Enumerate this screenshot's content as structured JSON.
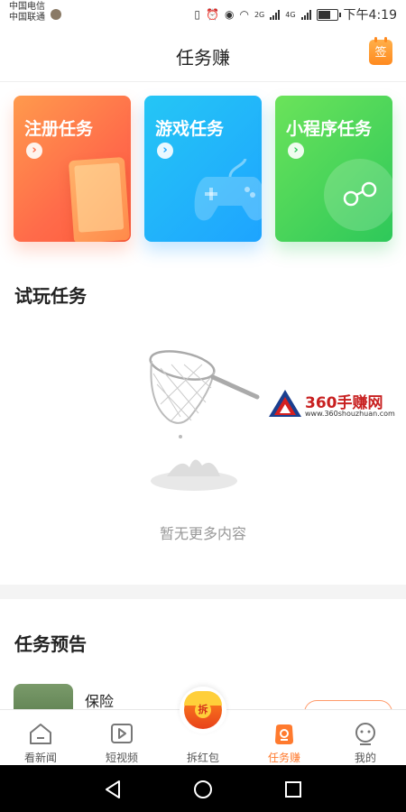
{
  "status_bar": {
    "carrier1": "中国电信",
    "carrier2": "中国联通",
    "net1": "2G",
    "net2": "4G",
    "time": "下午4:19"
  },
  "header": {
    "title": "任务赚",
    "sign_label": "签"
  },
  "task_cards": [
    {
      "title": "注册任务",
      "arrow": "›"
    },
    {
      "title": "游戏任务",
      "arrow": "›"
    },
    {
      "title": "小程序任务",
      "arrow": "›"
    }
  ],
  "trial_section": {
    "title": "试玩任务",
    "empty_text": "暂无更多内容"
  },
  "watermark": {
    "brand": "360手赚网",
    "url": "www.360shouzhuan.com"
  },
  "preview_section": {
    "title": "任务预告",
    "items": [
      {
        "name": "保险"
      }
    ]
  },
  "nav": {
    "items": [
      {
        "label": "看新闻"
      },
      {
        "label": "短视频"
      },
      {
        "label": "拆红包",
        "badge": "拆"
      },
      {
        "label": "任务赚"
      },
      {
        "label": "我的"
      }
    ],
    "active_index": 3,
    "active_color": "#ff7a2e"
  },
  "colors": {
    "accent": "#ff7a2e",
    "card_register": "#ff6b4a",
    "card_game": "#1ea4ff",
    "card_miniapp": "#2ec85a"
  }
}
